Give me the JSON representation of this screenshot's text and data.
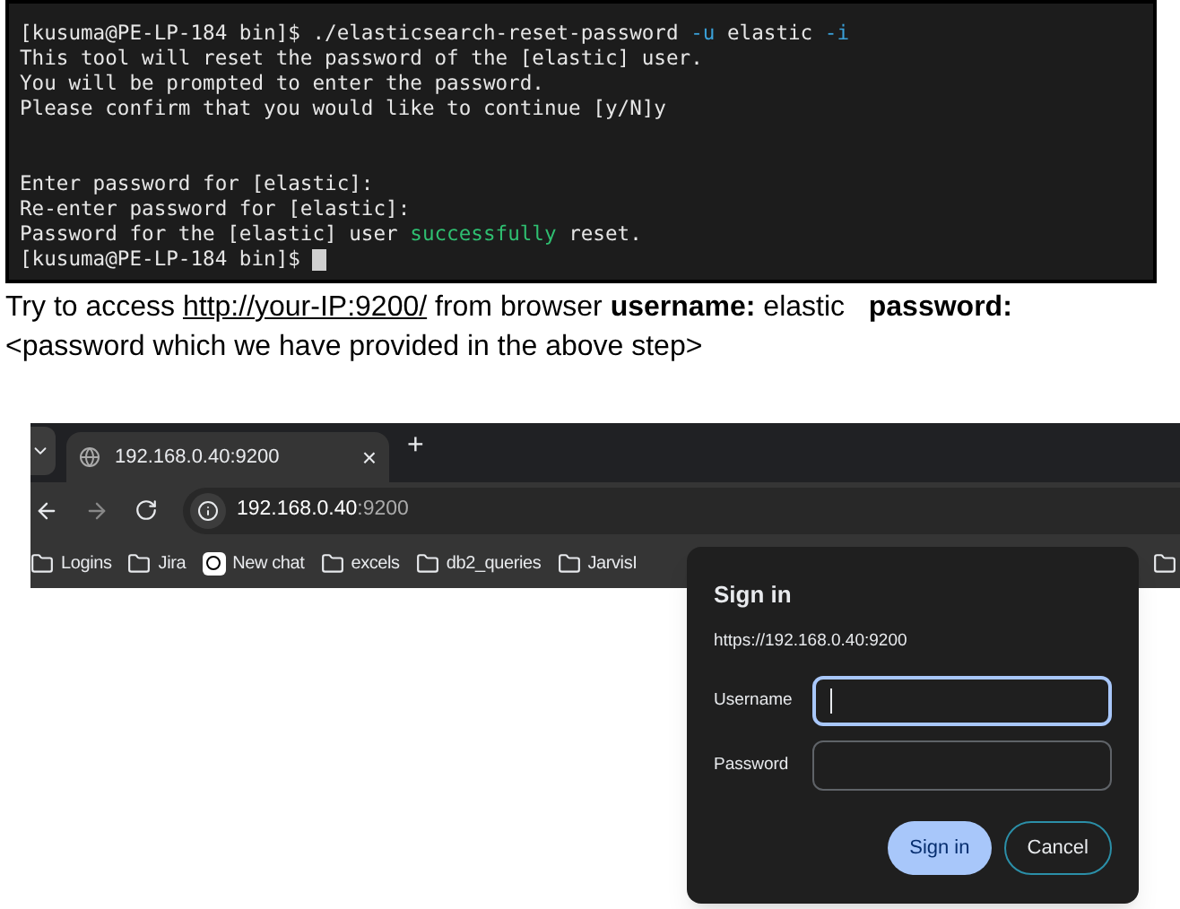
{
  "terminal": {
    "lines": [
      [
        {
          "text": "[kusuma@PE-LP-184 bin]$ ./elasticsearch-reset-password ",
          "kind": "plain"
        },
        {
          "text": "-u",
          "kind": "flag"
        },
        {
          "text": " elastic ",
          "kind": "plain"
        },
        {
          "text": "-i",
          "kind": "flag"
        }
      ],
      [
        {
          "text": "This tool will reset the password of the [elastic] user.",
          "kind": "plain"
        }
      ],
      [
        {
          "text": "You will be prompted to enter the password.",
          "kind": "plain"
        }
      ],
      [
        {
          "text": "Please confirm that you would like to continue [y/N]y",
          "kind": "plain"
        }
      ],
      [
        {
          "kind": "blank"
        }
      ],
      [
        {
          "kind": "blank"
        }
      ],
      [
        {
          "text": "Enter password for [elastic]:",
          "kind": "plain"
        }
      ],
      [
        {
          "text": "Re-enter password for [elastic]:",
          "kind": "plain"
        }
      ],
      [
        {
          "text": "Password for the [elastic] user ",
          "kind": "plain"
        },
        {
          "text": "successfully",
          "kind": "success"
        },
        {
          "text": " reset.",
          "kind": "plain"
        }
      ],
      [
        {
          "text": "[kusuma@PE-LP-184 bin]$ ",
          "kind": "plain"
        },
        {
          "kind": "cursor"
        }
      ]
    ]
  },
  "instruction": {
    "before": "Try to access ",
    "link": "http://your-IP:9200/",
    "after": " from browser **username:** elastic   **password:** <password which we have provided in the above step>"
  },
  "browser": {
    "tab": {
      "title": "192.168.0.40:9200",
      "close": "×",
      "new_tab": "+"
    },
    "address": {
      "host": "192.168.0.40",
      "port": ":9200"
    },
    "bookmarks": [
      {
        "label": "Logins",
        "kind": "folder"
      },
      {
        "label": "Jira",
        "kind": "folder"
      },
      {
        "label": "New chat",
        "kind": "app"
      },
      {
        "label": "excels",
        "kind": "folder"
      },
      {
        "label": "db2_queries",
        "kind": "folder"
      },
      {
        "label": "JarvisI",
        "kind": "folder"
      }
    ],
    "dialog": {
      "title": "Sign in",
      "origin": "https://192.168.0.40:9200",
      "fields": [
        {
          "label": "Username",
          "focused": true
        },
        {
          "label": "Password",
          "focused": false
        }
      ],
      "buttons": [
        {
          "label": "Sign in",
          "kind": "primary"
        },
        {
          "label": "Cancel",
          "kind": "secondary"
        }
      ]
    }
  }
}
